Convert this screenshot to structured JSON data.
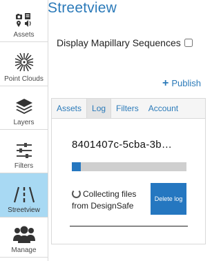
{
  "sidebar": {
    "items": [
      {
        "label": "Assets",
        "icon": "assets-icon",
        "active": false
      },
      {
        "label": "Point Clouds",
        "icon": "point-clouds-icon",
        "active": false
      },
      {
        "label": "Layers",
        "icon": "layers-icon",
        "active": false
      },
      {
        "label": "Filters",
        "icon": "filters-icon",
        "active": false
      },
      {
        "label": "Streetview",
        "icon": "streetview-icon",
        "active": true
      },
      {
        "label": "Manage",
        "icon": "manage-icon",
        "active": false
      }
    ]
  },
  "main": {
    "title": "Streetview",
    "mapillary_label": "Display Mapillary Sequences",
    "publish_label": "Publish",
    "tabs": [
      {
        "label": "Assets"
      },
      {
        "label": "Log"
      },
      {
        "label": "Filters"
      },
      {
        "label": "Account"
      }
    ],
    "active_tab": "Log",
    "log": {
      "id": "8401407c-5cba-3b…",
      "progress_percent": 8,
      "status_text": "Collecting files from DesignSafe",
      "delete_label": "Delete log"
    }
  },
  "colors": {
    "accent": "#2b7ab9",
    "button": "#2577c0",
    "active_nav": "#a8d9f3"
  }
}
